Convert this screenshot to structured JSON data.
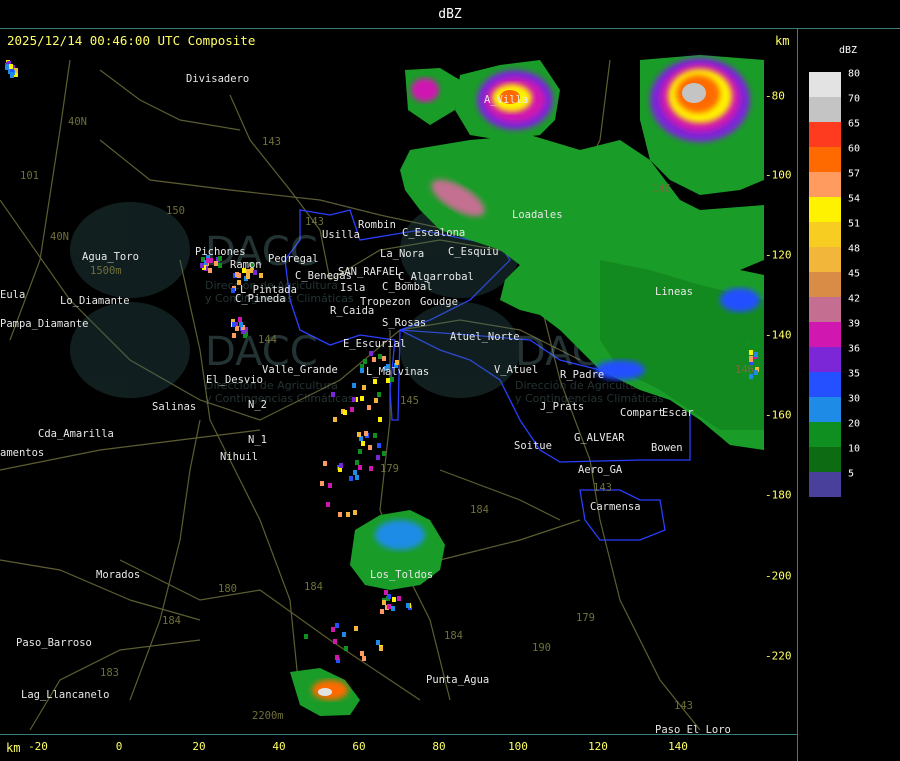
{
  "header": {
    "title": "dBZ"
  },
  "map": {
    "timestamp": "2025/12/14 00:46:00 UTC Composite",
    "km_unit": "km",
    "x_ticks": [
      "-20",
      "0",
      "20",
      "40",
      "60",
      "80",
      "100",
      "120",
      "140"
    ],
    "y_ticks": [
      "-80",
      "-100",
      "-120",
      "-140",
      "-160",
      "-180",
      "-200",
      "-220"
    ],
    "places": [
      {
        "name": "Divisadero",
        "cls": "place"
      },
      {
        "name": "A_Villa",
        "cls": "place"
      },
      {
        "name": "143",
        "cls": "route"
      },
      {
        "name": "40N",
        "cls": "route"
      },
      {
        "name": "101",
        "cls": "route"
      },
      {
        "name": "150",
        "cls": "route"
      },
      {
        "name": "143",
        "cls": "route"
      },
      {
        "name": "Rombin",
        "cls": "place"
      },
      {
        "name": "Usilla",
        "cls": "place"
      },
      {
        "name": "C_Escalona",
        "cls": "place"
      },
      {
        "name": "Loadales",
        "cls": "place"
      },
      {
        "name": "40N",
        "cls": "route"
      },
      {
        "name": "La_Nora",
        "cls": "place"
      },
      {
        "name": "C_Esquiu",
        "cls": "place"
      },
      {
        "name": "Agua_Toro",
        "cls": "place"
      },
      {
        "name": "Pichones",
        "cls": "place"
      },
      {
        "name": "Ramon",
        "cls": "place"
      },
      {
        "name": "Pedregal",
        "cls": "place"
      },
      {
        "name": "C_Benegas",
        "cls": "place"
      },
      {
        "name": "SAN_RAFAEL",
        "cls": "place"
      },
      {
        "name": "C_Algarrobal",
        "cls": "place"
      },
      {
        "name": "Isla",
        "cls": "place"
      },
      {
        "name": "C_Bombal",
        "cls": "place"
      },
      {
        "name": "Pampa_Diamante",
        "cls": "place"
      },
      {
        "name": "Eula",
        "cls": "place"
      },
      {
        "name": "Lo_Diamante",
        "cls": "place"
      },
      {
        "name": "L_Pintada",
        "cls": "place"
      },
      {
        "name": "C_Pineda",
        "cls": "place"
      },
      {
        "name": "R_Caida",
        "cls": "place"
      },
      {
        "name": "Tropezon",
        "cls": "place"
      },
      {
        "name": "Goudge",
        "cls": "place"
      },
      {
        "name": "S_Rosas",
        "cls": "place"
      },
      {
        "name": "Atuel_Norte",
        "cls": "place"
      },
      {
        "name": "E_Escurial",
        "cls": "place"
      },
      {
        "name": "Valle_Grande",
        "cls": "place"
      },
      {
        "name": "L_Malvinas",
        "cls": "place"
      },
      {
        "name": "V_Atuel",
        "cls": "place"
      },
      {
        "name": "R_Padre",
        "cls": "place"
      },
      {
        "name": "El_Desvio",
        "cls": "place"
      },
      {
        "name": "144",
        "cls": "route"
      },
      {
        "name": "Salinas",
        "cls": "place"
      },
      {
        "name": "N_2",
        "cls": "place"
      },
      {
        "name": "J_Prats",
        "cls": "place"
      },
      {
        "name": "Compart",
        "cls": "place"
      },
      {
        "name": "Escar",
        "cls": "place"
      },
      {
        "name": "Cda_Amarilla",
        "cls": "place"
      },
      {
        "name": "amentos",
        "cls": "place"
      },
      {
        "name": "N_1",
        "cls": "place"
      },
      {
        "name": "Nihuil",
        "cls": "place"
      },
      {
        "name": "G_ALVEAR",
        "cls": "place"
      },
      {
        "name": "Soitue",
        "cls": "place"
      },
      {
        "name": "Bowen",
        "cls": "place"
      },
      {
        "name": "Aero_GA",
        "cls": "place"
      },
      {
        "name": "179",
        "cls": "route"
      },
      {
        "name": "143",
        "cls": "route"
      },
      {
        "name": "184",
        "cls": "route"
      },
      {
        "name": "Carmensa",
        "cls": "place"
      },
      {
        "name": "Los_Toldos",
        "cls": "place"
      },
      {
        "name": "Morados",
        "cls": "place"
      },
      {
        "name": "180",
        "cls": "route"
      },
      {
        "name": "184",
        "cls": "route"
      },
      {
        "name": "184",
        "cls": "route"
      },
      {
        "name": "Paso_Barroso",
        "cls": "place"
      },
      {
        "name": "179",
        "cls": "route"
      },
      {
        "name": "184",
        "cls": "route"
      },
      {
        "name": "190",
        "cls": "route"
      },
      {
        "name": "183",
        "cls": "route"
      },
      {
        "name": "Punta_Agua",
        "cls": "place"
      },
      {
        "name": "Lag_Llancanelo",
        "cls": "place"
      },
      {
        "name": "2200m",
        "cls": "route"
      },
      {
        "name": "143",
        "cls": "route"
      },
      {
        "name": "Paso_El_Loro",
        "cls": "place"
      },
      {
        "name": "146",
        "cls": "route"
      },
      {
        "name": "Lineas",
        "cls": "place"
      },
      {
        "name": "1500m",
        "cls": "route"
      },
      {
        "name": "146",
        "cls": "route"
      },
      {
        "name": "145",
        "cls": "route"
      }
    ],
    "watermark": {
      "logo": "DACC",
      "line1": "Dirección de Agricultura",
      "line2": "y Contingencias Climáticas"
    },
    "colors": {
      "bg": "#000000",
      "yellow": "#ffff66",
      "route": "#6f6f3a",
      "border": "#2a3fff",
      "frame": "#3a7d7d"
    }
  },
  "legend": {
    "title": "dBZ",
    "entries": [
      {
        "value": "80",
        "color": "#e3e3e3"
      },
      {
        "value": "70",
        "color": "#c4c4c4"
      },
      {
        "value": "65",
        "color": "#ff3b1f"
      },
      {
        "value": "60",
        "color": "#ff6a00"
      },
      {
        "value": "57",
        "color": "#ff9b5e"
      },
      {
        "value": "54",
        "color": "#fff200"
      },
      {
        "value": "51",
        "color": "#f6cd20"
      },
      {
        "value": "48",
        "color": "#f2b63a"
      },
      {
        "value": "45",
        "color": "#d88c45"
      },
      {
        "value": "42",
        "color": "#c46f91"
      },
      {
        "value": "39",
        "color": "#d018b0"
      },
      {
        "value": "36",
        "color": "#7b27d8"
      },
      {
        "value": "35",
        "color": "#2450ff"
      },
      {
        "value": "30",
        "color": "#1e8ce6"
      },
      {
        "value": "20",
        "color": "#0e8f20"
      },
      {
        "value": "10",
        "color": "#0c6b13"
      },
      {
        "value": "5",
        "color": "#48409a"
      }
    ]
  }
}
